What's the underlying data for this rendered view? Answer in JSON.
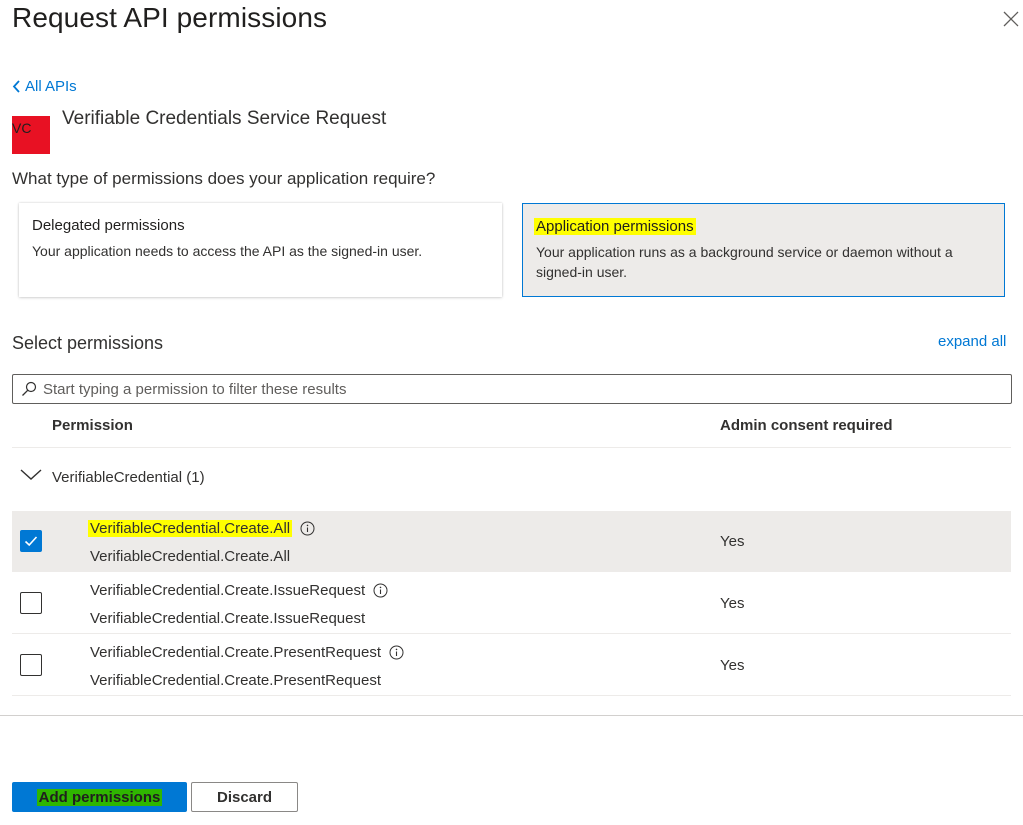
{
  "panel": {
    "title": "Request API permissions",
    "close_icon": "close-icon"
  },
  "back_link": {
    "label": "All APIs",
    "icon": "chevron-left-icon"
  },
  "api": {
    "logo_text": "VC",
    "logo_color": "#e81123",
    "name": "Verifiable Credentials Service Request"
  },
  "permission_type": {
    "question": "What type of permissions does your application require?",
    "delegated": {
      "title": "Delegated permissions",
      "description": "Your application needs to access the API as the signed-in user.",
      "selected": false
    },
    "application": {
      "title": "Application permissions",
      "description": "Your application runs as a background service or daemon without a signed-in user.",
      "selected": true
    }
  },
  "select_permissions": {
    "label": "Select permissions",
    "expand_all": "expand all",
    "search_placeholder": "Start typing a permission to filter these results",
    "columns": {
      "permission": "Permission",
      "admin_consent": "Admin consent required"
    },
    "group": {
      "label": "VerifiableCredential (1)",
      "expanded": true
    },
    "rows": [
      {
        "name": "VerifiableCredential.Create.All",
        "description": "VerifiableCredential.Create.All",
        "admin_consent": "Yes",
        "checked": true
      },
      {
        "name": "VerifiableCredential.Create.IssueRequest",
        "description": "VerifiableCredential.Create.IssueRequest",
        "admin_consent": "Yes",
        "checked": false
      },
      {
        "name": "VerifiableCredential.Create.PresentRequest",
        "description": "VerifiableCredential.Create.PresentRequest",
        "admin_consent": "Yes",
        "checked": false
      }
    ]
  },
  "footer": {
    "add_label": "Add permissions",
    "discard_label": "Discard"
  },
  "colors": {
    "accent": "#0078d4",
    "highlight_yellow": "#ffff00",
    "highlight_green": "#2fb600",
    "selected_bg": "#edebe9"
  }
}
